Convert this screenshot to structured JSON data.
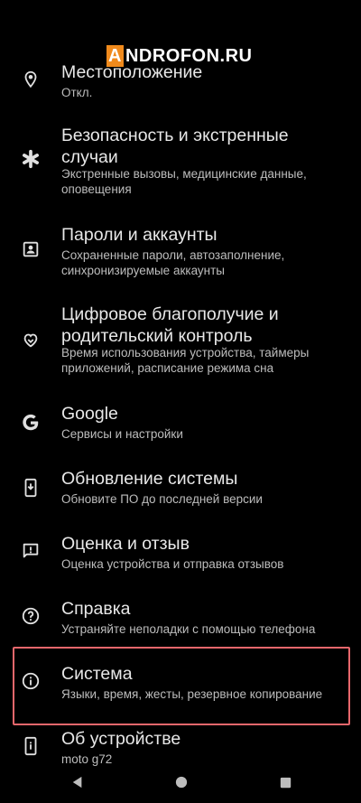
{
  "watermark": {
    "first_letter": "A",
    "rest": "NDROFON.RU"
  },
  "items": [
    {
      "title": "Местоположение",
      "sub": "Откл.",
      "icon": "location-pin-icon"
    },
    {
      "title": "Безопасность и экстренные случаи",
      "sub": "Экстренные вызовы, медицинские данные, оповещения",
      "icon": "asterisk-icon"
    },
    {
      "title": "Пароли и аккаунты",
      "sub": "Сохраненные пароли, автозаполнение, синхронизируемые аккаунты",
      "icon": "account-box-icon"
    },
    {
      "title": "Цифровое благополучие и родительский контроль",
      "sub": "Время использования устройства, таймеры приложений, расписание режима сна",
      "icon": "wellbeing-icon"
    },
    {
      "title": "Google",
      "sub": "Сервисы и настройки",
      "icon": "google-icon"
    },
    {
      "title": "Обновление системы",
      "sub": "Обновите ПО до последней версии",
      "icon": "system-update-icon"
    },
    {
      "title": "Оценка и отзыв",
      "sub": "Оценка устройства и отправка отзывов",
      "icon": "feedback-icon"
    },
    {
      "title": "Справка",
      "sub": "Устраняйте неполадки с помощью телефона",
      "icon": "help-icon"
    },
    {
      "title": "Система",
      "sub": "Языки, время, жесты, резервное копирование",
      "icon": "info-icon"
    },
    {
      "title": "Об устройстве",
      "sub": "moto g72",
      "icon": "phone-info-icon"
    }
  ],
  "highlight_color": "#e8676c",
  "navbar": {
    "back": "back-icon",
    "home": "home-icon",
    "recents": "recents-icon"
  }
}
